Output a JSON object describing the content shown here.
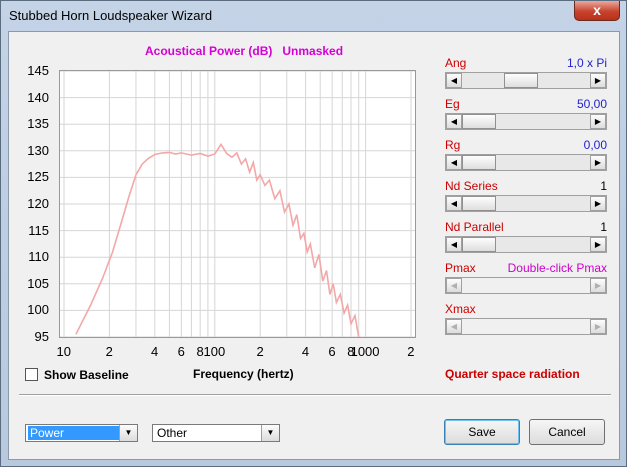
{
  "window": {
    "title": "Stubbed Horn Loudspeaker Wizard",
    "close_label": "x"
  },
  "chart_data": {
    "type": "line",
    "title": "Acoustical Power (dB)   Unmasked",
    "xlabel": "Frequency (hertz)",
    "ylabel": "",
    "xscale": "log",
    "xlim": [
      10,
      2000
    ],
    "ylim": [
      95,
      145
    ],
    "ytick_labels": [
      "145",
      "140",
      "135",
      "130",
      "125",
      "120",
      "115",
      "110",
      "105",
      "100",
      "95"
    ],
    "xtick_labels": [
      "10",
      "2",
      "4",
      "6",
      "8",
      "100",
      "2",
      "4",
      "6",
      "8",
      "1000",
      "2"
    ],
    "grid": true,
    "series": [
      {
        "color": "#f4a7a7",
        "x": [
          12,
          15,
          18,
          21,
          24,
          27,
          30,
          33,
          36,
          40,
          45,
          50,
          55,
          60,
          70,
          80,
          90,
          100,
          110,
          120,
          130,
          140,
          150,
          160,
          170,
          180,
          190,
          200,
          215,
          230,
          250,
          270,
          290,
          310,
          330,
          350,
          370,
          390,
          410,
          430,
          460,
          490,
          520,
          550,
          580,
          610,
          640,
          680,
          720,
          760,
          800,
          850,
          900
        ],
        "y": [
          95.5,
          101,
          106,
          111,
          116.5,
          121.5,
          125.5,
          127.5,
          128.5,
          129.3,
          129.6,
          129.7,
          129.4,
          129.6,
          129.2,
          129.5,
          129,
          129.4,
          131.2,
          129.5,
          128.8,
          129.6,
          127.5,
          128.5,
          126,
          127.8,
          124.5,
          125.5,
          123.5,
          124.5,
          121,
          122.5,
          118.5,
          120,
          116,
          118,
          113.5,
          114.5,
          111,
          112.5,
          108,
          110.5,
          105.5,
          107.5,
          103,
          105,
          101.5,
          103,
          99.5,
          101,
          97.5,
          99,
          95
        ]
      }
    ]
  },
  "controls": {
    "show_baseline_label": "Show Baseline",
    "show_baseline_checked": false,
    "radiation_label": "Quarter space radiation"
  },
  "params": [
    {
      "name": "Ang",
      "value": "1,0 x Pi",
      "position": 0.45,
      "enabled": true
    },
    {
      "name": "Eg",
      "value": "50,00",
      "position": 0.0,
      "enabled": true
    },
    {
      "name": "Rg",
      "value": "0,00",
      "position": 0.0,
      "enabled": true
    },
    {
      "name": "Nd Series",
      "value": "1",
      "position": 0.0,
      "enabled": true
    },
    {
      "name": "Nd Parallel",
      "value": "1",
      "position": 0.0,
      "enabled": true
    },
    {
      "name": "Pmax",
      "value": "Double-click Pmax",
      "position": null,
      "enabled": false
    },
    {
      "name": "Xmax",
      "value": "",
      "position": null,
      "enabled": false
    }
  ],
  "footer": {
    "left_combo_value": "Power",
    "right_combo_value": "Other",
    "save_label": "Save",
    "cancel_label": "Cancel"
  }
}
